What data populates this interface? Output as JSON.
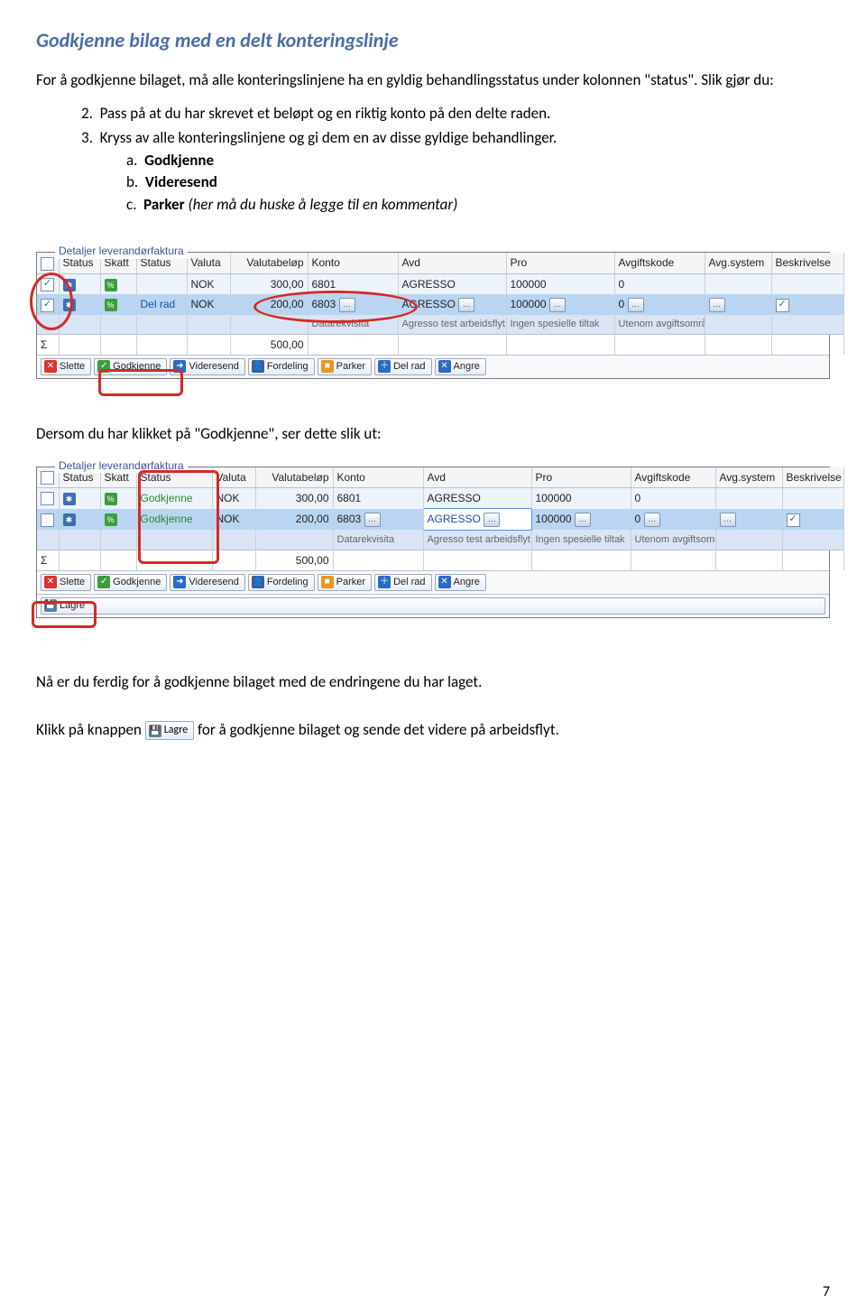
{
  "heading": "Godkjenne bilag med en delt konteringslinje",
  "intro": "For å godkjenne bilaget, må alle konteringslinjene ha en gyldig behandlingsstatus under kolonnen \"status\". Slik gjør du:",
  "steps": {
    "s2": "Pass på at du har skrevet et beløpt og en riktig konto på den delte raden.",
    "s3": "Kryss av alle konteringslinjene og gi dem en av disse gyldige behandlinger.",
    "a_label": "Godkjenne",
    "b_label": "Videresend",
    "c_label": "Parker",
    "c_tail": "(her må du huske å legge til en kommentar)"
  },
  "legend": "Detaljer leverandørfaktura",
  "cols": {
    "status1": "Status",
    "skatt": "Skatt",
    "status2": "Status",
    "valuta": "Valuta",
    "belop": "Valutabeløp",
    "konto": "Konto",
    "avd": "Avd",
    "pro": "Pro",
    "avgkode": "Avgiftskode",
    "avgsys": "Avg.system",
    "beskr": "Beskrivelse"
  },
  "shot1": {
    "r1": {
      "valuta": "NOK",
      "belop": "300,00",
      "konto": "6801",
      "avd": "AGRESSO",
      "pro": "100000",
      "kode": "0"
    },
    "r2": {
      "status": "Del rad",
      "valuta": "NOK",
      "belop": "200,00",
      "konto": "6803",
      "avd": "AGRESSO",
      "pro": "100000",
      "kode": "0"
    },
    "desc": {
      "konto": "Datarekvisita",
      "avd": "Agresso test arbeidsflyt",
      "pro": "Ingen spesielle tiltak",
      "kode": "Utenom avgiftsområdet"
    },
    "sum": "500,00",
    "sigma": "Σ"
  },
  "toolbar": {
    "slette": "Slette",
    "godkjenne": "Godkjenne",
    "videresend": "Videresend",
    "fordeling": "Fordeling",
    "parker": "Parker",
    "delrad": "Del rad",
    "angre": "Angre",
    "lagre": "Lagre"
  },
  "mid_text": "Dersom du har klikket på \"Godkjenne\", ser dette slik ut:",
  "shot2": {
    "r1": {
      "status": "Godkjenne",
      "valuta": "NOK",
      "belop": "300,00",
      "konto": "6801",
      "avd": "AGRESSO",
      "pro": "100000",
      "kode": "0"
    },
    "r2": {
      "status": "Godkjenne",
      "valuta": "NOK",
      "belop": "200,00",
      "konto": "6803",
      "avd": "AGRESSO",
      "pro": "100000",
      "kode": "0"
    },
    "desc": {
      "konto": "Datarekvisita",
      "avd": "Agresso test arbeidsflyt",
      "pro": "Ingen spesielle tiltak",
      "kode": "Utenom avgiftsområdet"
    },
    "sum": "500,00"
  },
  "after1": "Nå er du ferdig for å godkjenne bilaget med de endringene du har laget.",
  "after2_a": "Klikk på knappen",
  "after2_b": "for å godkjenne bilaget og sende det videre på arbeidsflyt.",
  "pagenum": "7"
}
